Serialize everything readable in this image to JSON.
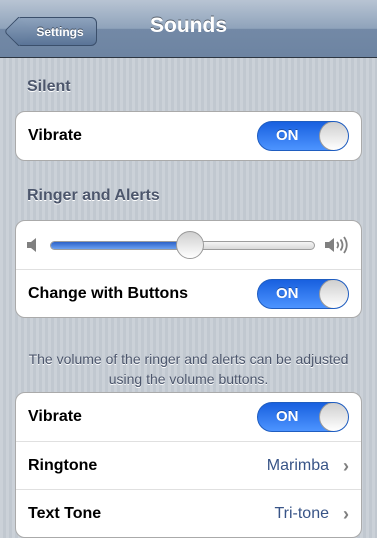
{
  "navbar": {
    "back_label": "Settings",
    "title": "Sounds"
  },
  "silent": {
    "header": "Silent",
    "vibrate_label": "Vibrate",
    "vibrate_toggle": "ON"
  },
  "ringer": {
    "header": "Ringer and Alerts",
    "volume_level": 0.53,
    "change_with_buttons_label": "Change with Buttons",
    "change_with_buttons_toggle": "ON",
    "note": "The volume of the ringer and alerts can be adjusted using the volume buttons."
  },
  "sounds": {
    "vibrate_label": "Vibrate",
    "vibrate_toggle": "ON",
    "ringtone_label": "Ringtone",
    "ringtone_value": "Marimba",
    "text_tone_label": "Text Tone",
    "text_tone_value": "Tri-tone"
  },
  "icons": {
    "volume_min": "speaker-low-icon",
    "volume_max": "speaker-high-icon",
    "disclosure": "chevron-right-icon"
  },
  "colors": {
    "toggle_on": "#2f74ee",
    "value_text": "#385487",
    "section_header": "#4c566c"
  }
}
